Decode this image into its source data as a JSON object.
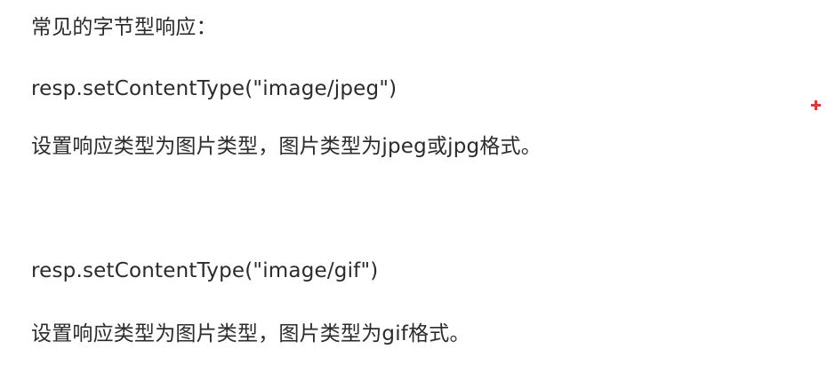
{
  "document": {
    "heading": "常见的字节型响应：",
    "items": [
      {
        "code": "resp.setContentType(\"image/jpeg\")",
        "description": "设置响应类型为图片类型，图片类型为jpeg或jpg格式。"
      },
      {
        "code": "resp.setContentType(\"image/gif\")",
        "description": "设置响应类型为图片类型，图片类型为gif格式。"
      }
    ]
  },
  "cursor_marker": {
    "icon": "crosshair-icon",
    "color": "#e03a3a"
  }
}
